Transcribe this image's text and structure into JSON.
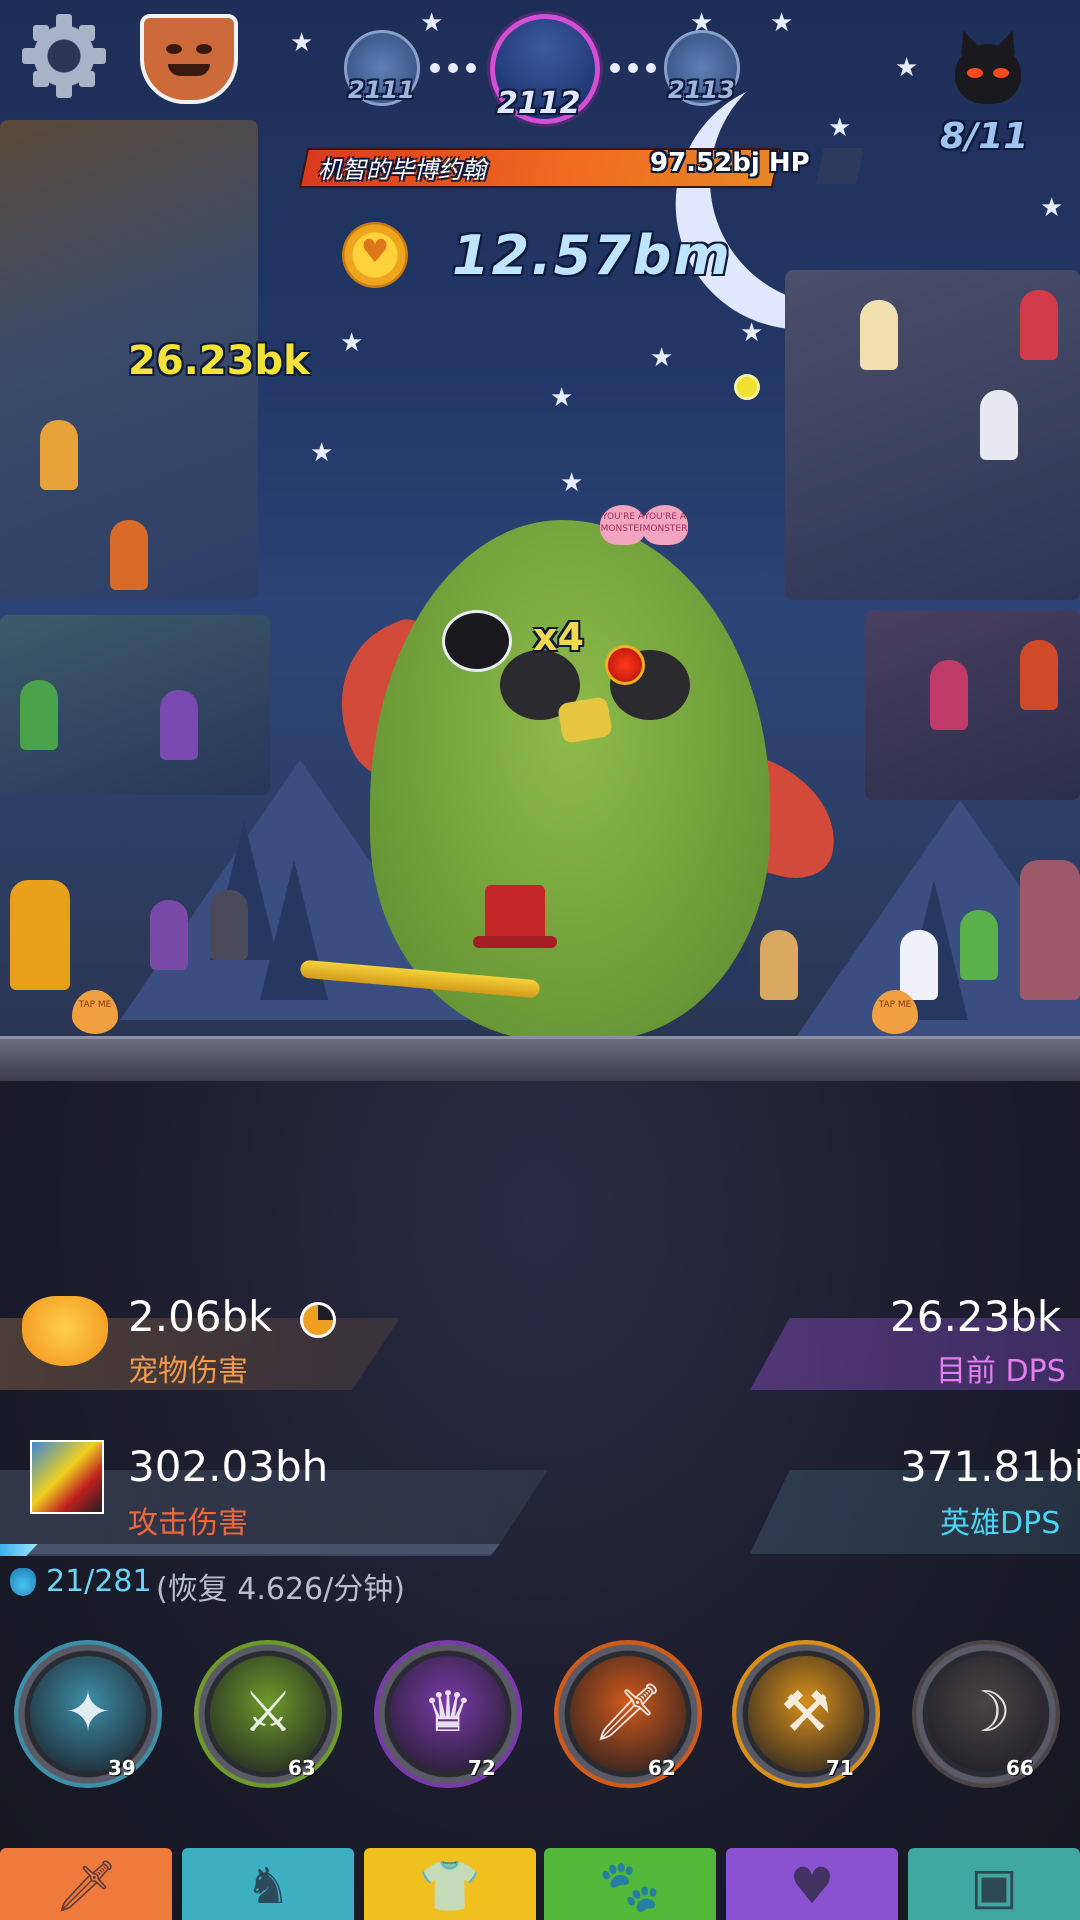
{
  "header": {
    "settings_icon": "gear-icon",
    "boss_icon": "boss-shield-icon",
    "stages": {
      "prev": "2111",
      "current": "2112",
      "next": "2113"
    },
    "wave_counter": "8/11"
  },
  "boss": {
    "name": "机智的毕博约翰",
    "hp": "97.52bj",
    "hp_unit": "HP",
    "hp_fraction": 0.84
  },
  "gold": {
    "amount": "12.57bm",
    "icon": "heart-coin-icon"
  },
  "floating": {
    "damage_text": "26.23bk",
    "multiplier": "x4"
  },
  "bubbles": [
    "YOU'RE A MONSTER",
    "YOU'RE A MONSTER"
  ],
  "tap_labels": [
    "TAP ME",
    "TAP ME"
  ],
  "stats": {
    "pet_damage": {
      "value": "2.06bk",
      "label": "宠物伤害",
      "cooldown_fraction": 0.75
    },
    "current_dps": {
      "value": "26.23bk",
      "label_cn": "目前",
      "label_en": "DPS"
    },
    "tap_damage": {
      "value": "302.03bh",
      "label": "攻击伤害"
    },
    "hero_dps": {
      "value": "371.81bi",
      "label": "英雄DPS"
    }
  },
  "mana": {
    "current": "21/281",
    "regen": "(恢复 4.626/分钟)",
    "icon": "mana-potion-icon",
    "progress_fraction": 0.075
  },
  "skills": [
    {
      "name": "heavenly-strike-icon",
      "level": "39",
      "color": "#3d8fa8"
    },
    {
      "name": "deadly-strike-icon",
      "level": "63",
      "color": "#6d9a2a"
    },
    {
      "name": "hand-of-midas-icon",
      "level": "72",
      "color": "#7a3aa8"
    },
    {
      "name": "fire-sword-icon",
      "level": "62",
      "color": "#d05a1a"
    },
    {
      "name": "war-cry-icon",
      "level": "71",
      "color": "#d8901a"
    },
    {
      "name": "shadow-clone-icon",
      "level": "66",
      "color": "#4a4446"
    }
  ],
  "tabs": [
    {
      "name": "sword-tab-icon",
      "color": "#f07a3c"
    },
    {
      "name": "heroes-tab-icon",
      "color": "#3cb0c0"
    },
    {
      "name": "equipment-tab-icon",
      "color": "#f0c020"
    },
    {
      "name": "pets-tab-icon",
      "color": "#52b83a"
    },
    {
      "name": "clan-tab-icon",
      "color": "#8a52d0"
    },
    {
      "name": "shop-tab-icon",
      "color": "#3fa6a0"
    }
  ]
}
